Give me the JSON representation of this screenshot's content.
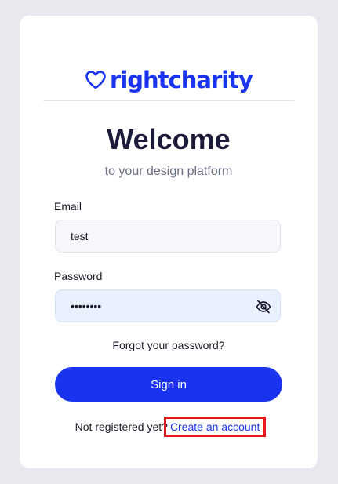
{
  "brand": {
    "name": "rightcharity",
    "color": "#1a33ee"
  },
  "heading": {
    "title": "Welcome",
    "subtitle": "to your design platform"
  },
  "form": {
    "email_label": "Email",
    "email_value": "test",
    "password_label": "Password",
    "password_value": "••••••••",
    "password_toggle_icon": "eye-slash-icon",
    "forgot_link": "Forgot your password?",
    "submit_label": "Sign in"
  },
  "register": {
    "prompt": "Not registered yet?",
    "link": "Create an account",
    "highlight_color": "#e8171d"
  }
}
